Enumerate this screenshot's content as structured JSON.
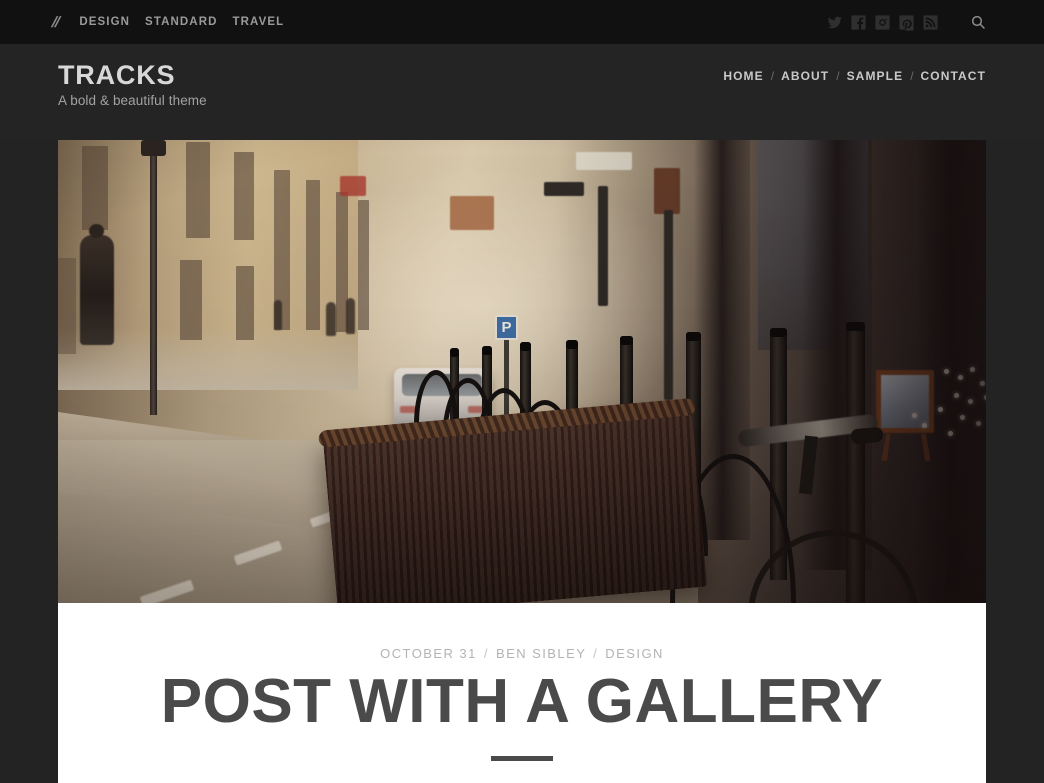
{
  "topbar": {
    "logo": "//",
    "categories": [
      {
        "label": "DESIGN"
      },
      {
        "label": "STANDARD"
      },
      {
        "label": "TRAVEL"
      }
    ],
    "social": [
      {
        "name": "twitter-icon",
        "label": "Twitter"
      },
      {
        "name": "facebook-icon",
        "label": "Facebook"
      },
      {
        "name": "instagram-icon",
        "label": "Instagram"
      },
      {
        "name": "pinterest-icon",
        "label": "Pinterest"
      },
      {
        "name": "rss-icon",
        "label": "RSS"
      }
    ],
    "search": {
      "label": "Search",
      "icon": "search-icon"
    }
  },
  "header": {
    "site_title": "TRACKS",
    "tagline": "A bold & beautiful theme",
    "nav": [
      {
        "label": "HOME"
      },
      {
        "label": "ABOUT"
      },
      {
        "label": "SAMPLE"
      },
      {
        "label": "CONTACT"
      }
    ],
    "nav_separator": "/"
  },
  "featured_image": {
    "alt": "Misty European street with bicycle racks, parked white SUV and a wicker bicycle basket in the foreground"
  },
  "post": {
    "date": "OCTOBER 31",
    "author": "BEN SIBLEY",
    "category": "DESIGN",
    "meta_separator": "/",
    "title": "POST WITH A GALLERY"
  },
  "colors": {
    "topbar_bg": "#111111",
    "header_bg": "#242424",
    "page_bg": "#232323",
    "card_bg": "#ffffff",
    "title_text": "#4a4a4a",
    "meta_text": "#b3b3b3",
    "site_title_text": "#d8d8d8",
    "nav_text": "#c9c9c9"
  }
}
